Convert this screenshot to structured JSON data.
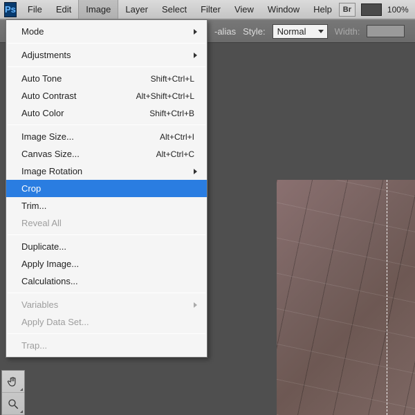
{
  "menubar": {
    "items": [
      "File",
      "Edit",
      "Image",
      "Layer",
      "Select",
      "Filter",
      "View",
      "Window",
      "Help"
    ],
    "open_index": 2,
    "bridge_label": "Br",
    "zoom": "100%"
  },
  "options": {
    "antialias_label": "-alias",
    "style_label": "Style:",
    "style_value": "Normal",
    "width_label": "Width:"
  },
  "dropdown": {
    "groups": [
      [
        {
          "label": "Mode",
          "submenu": true
        }
      ],
      [
        {
          "label": "Adjustments",
          "submenu": true
        }
      ],
      [
        {
          "label": "Auto Tone",
          "shortcut": "Shift+Ctrl+L"
        },
        {
          "label": "Auto Contrast",
          "shortcut": "Alt+Shift+Ctrl+L"
        },
        {
          "label": "Auto Color",
          "shortcut": "Shift+Ctrl+B"
        }
      ],
      [
        {
          "label": "Image Size...",
          "shortcut": "Alt+Ctrl+I"
        },
        {
          "label": "Canvas Size...",
          "shortcut": "Alt+Ctrl+C"
        },
        {
          "label": "Image Rotation",
          "submenu": true
        },
        {
          "label": "Crop",
          "highlight": true
        },
        {
          "label": "Trim..."
        },
        {
          "label": "Reveal All",
          "disabled": true
        }
      ],
      [
        {
          "label": "Duplicate..."
        },
        {
          "label": "Apply Image..."
        },
        {
          "label": "Calculations..."
        }
      ],
      [
        {
          "label": "Variables",
          "submenu": true,
          "disabled": true
        },
        {
          "label": "Apply Data Set...",
          "disabled": true
        }
      ],
      [
        {
          "label": "Trap...",
          "disabled": true
        }
      ]
    ]
  },
  "tools": {
    "items": [
      "hand-tool",
      "zoom-tool"
    ]
  },
  "logo_text": "Ps"
}
